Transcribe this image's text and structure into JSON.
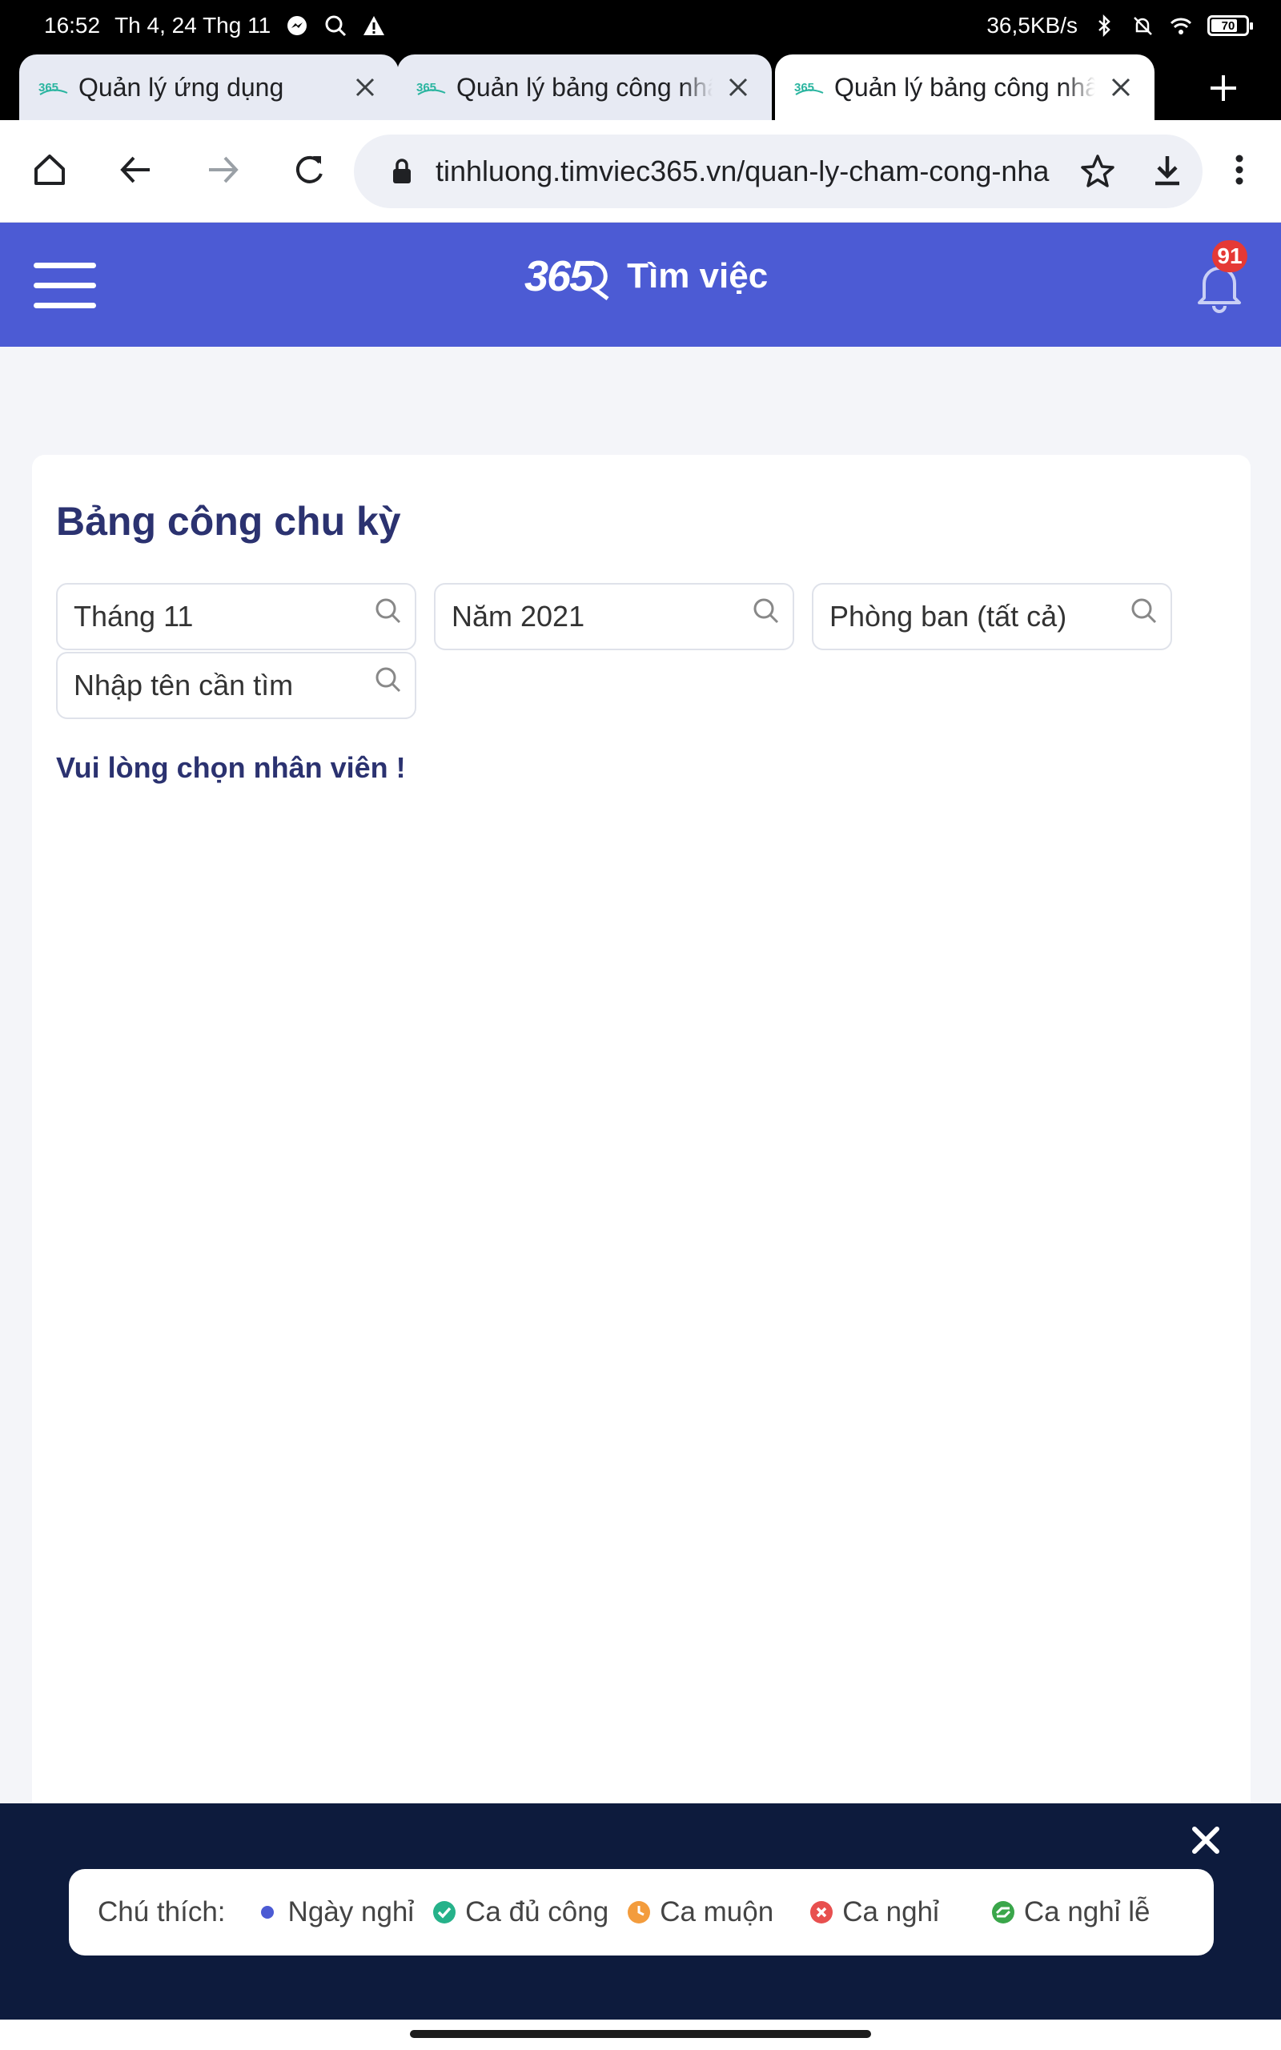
{
  "status_bar": {
    "time": "16:52",
    "date": "Th 4, 24 Thg 11",
    "network_speed": "36,5KB/s",
    "battery": "70"
  },
  "tabs": [
    {
      "title": "Quản lý ứng dụng",
      "active": false
    },
    {
      "title": "Quản lý bảng công nhân",
      "active": false
    },
    {
      "title": "Quản lý bảng công nhân",
      "active": true
    }
  ],
  "address_bar": {
    "url": "tinhluong.timviec365.vn/quan-ly-cham-cong-nha"
  },
  "site_header": {
    "logo_mark": "365",
    "logo_text": "Tìm việc",
    "notification_count": "91",
    "brand_color": "#4c5bd4"
  },
  "card": {
    "title": "Bảng công chu kỳ",
    "filters": {
      "month": "Tháng 11",
      "year": "Năm 2021",
      "department": "Phòng ban (tất cả)",
      "search_placeholder": "Nhập tên cần tìm"
    },
    "notice": "Vui lòng chọn nhân viên !"
  },
  "legend": {
    "label": "Chú thích:",
    "items": [
      {
        "name": "Ngày nghỉ",
        "color": "#4c5bd4",
        "icon": "dot-icon"
      },
      {
        "name": "Ca đủ công",
        "color": "#26b28a",
        "icon": "check-circle-icon"
      },
      {
        "name": "Ca muộn",
        "color": "#f39c3d",
        "icon": "clock-icon"
      },
      {
        "name": "Ca nghỉ",
        "color": "#e8504f",
        "icon": "x-circle-icon"
      },
      {
        "name": "Ca nghỉ lễ",
        "color": "#3aa64a",
        "icon": "holiday-icon"
      }
    ]
  }
}
